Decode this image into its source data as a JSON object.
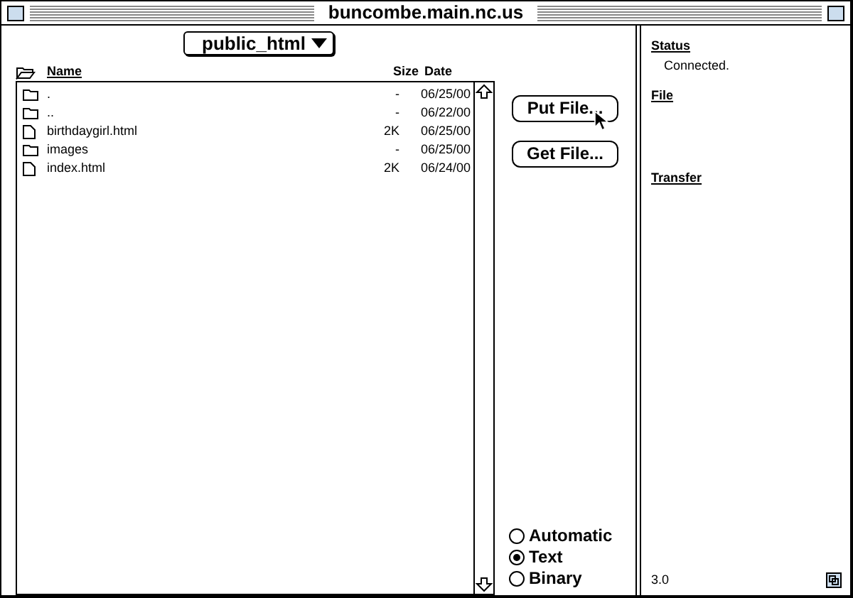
{
  "window": {
    "title": "buncombe.main.nc.us"
  },
  "folder_menu": {
    "label": "public_html"
  },
  "columns": {
    "name": "Name",
    "size": "Size",
    "date": "Date"
  },
  "files": [
    {
      "kind": "folder",
      "name": ".",
      "size": "-",
      "date": "06/25/00"
    },
    {
      "kind": "folder",
      "name": "..",
      "size": "-",
      "date": "06/22/00"
    },
    {
      "kind": "file",
      "name": "birthdaygirl.html",
      "size": "2K",
      "date": "06/25/00"
    },
    {
      "kind": "folder",
      "name": "images",
      "size": "-",
      "date": "06/25/00"
    },
    {
      "kind": "file",
      "name": "index.html",
      "size": "2K",
      "date": "06/24/00"
    }
  ],
  "buttons": [
    "Put File...",
    "Get File..."
  ],
  "modes": [
    {
      "label": "Automatic",
      "selected": false
    },
    {
      "label": "Text",
      "selected": true
    },
    {
      "label": "Binary",
      "selected": false
    }
  ],
  "status_panel": {
    "status_label": "Status",
    "status": "Connected.",
    "file_label": "File",
    "transfer_label": "Transfer",
    "version": "3.0"
  }
}
